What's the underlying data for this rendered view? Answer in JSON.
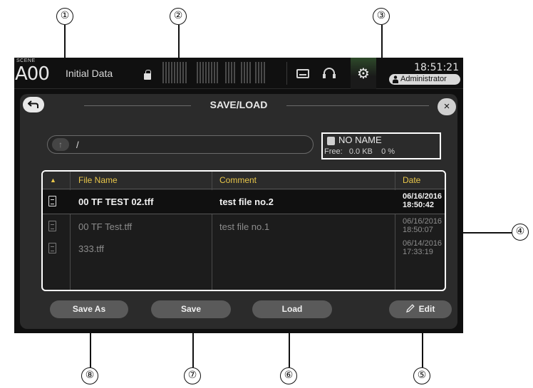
{
  "callouts": [
    "①",
    "②",
    "③",
    "④",
    "⑤",
    "⑥",
    "⑦",
    "⑧"
  ],
  "topbar": {
    "scene_tag": "SCENE",
    "scene_number": "A00",
    "scene_title": "Initial Data",
    "clock": "18:51:21",
    "user": "Administrator"
  },
  "panel": {
    "title": "SAVE/LOAD",
    "back_icon": "back-arrow-icon",
    "close_label": "×"
  },
  "path": {
    "up_label": "↑",
    "current": "/"
  },
  "media": {
    "name": "NO NAME",
    "free_label": "Free:",
    "free_size": "0.0 KB",
    "free_percent": "0 %"
  },
  "table": {
    "sort_indicator": "▲",
    "headers": {
      "name": "File Name",
      "comment": "Comment",
      "date": "Date"
    },
    "rows": [
      {
        "name": "00 TF TEST 02.tff",
        "comment": "test file no.2",
        "date": "06/16/2016",
        "time": "18:50:42"
      },
      {
        "name": "00 TF Test.tff",
        "comment": "test file no.1",
        "date": "06/16/2016",
        "time": "18:50:07"
      },
      {
        "name": "333.tff",
        "comment": "",
        "date": "06/14/2016",
        "time": "17:33:19"
      }
    ]
  },
  "buttons": {
    "save_as": "Save As",
    "save": "Save",
    "load": "Load",
    "edit": "Edit"
  },
  "colors": {
    "header_text": "#e8c64a",
    "callout_box": "#ffffff",
    "panel_bg": "#2b2b2b"
  }
}
